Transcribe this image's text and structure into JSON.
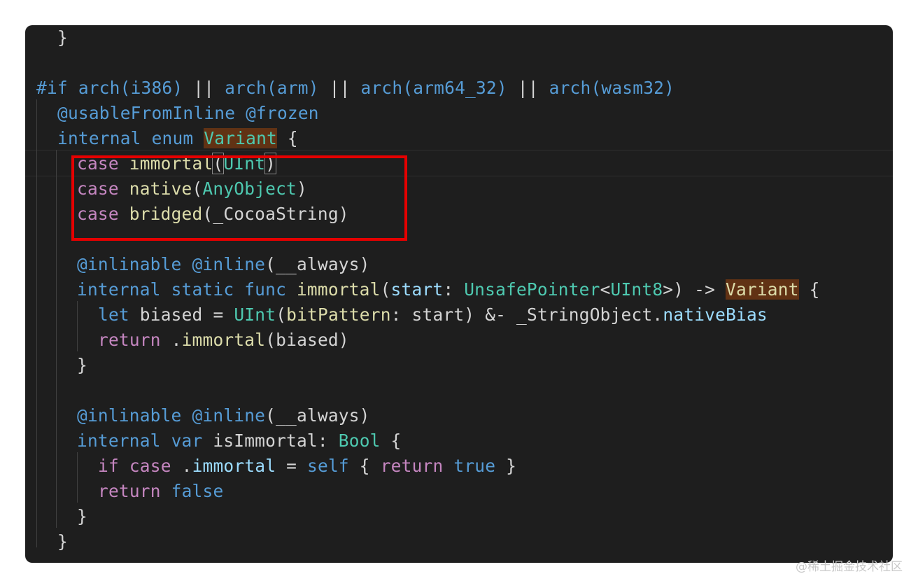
{
  "code": {
    "l1_brace": "}",
    "l3_if": "#if",
    "l3_arch1": "arch(i386)",
    "l3_or1": " || ",
    "l3_arch2": "arch(arm)",
    "l3_or2": " || ",
    "l3_arch3": "arch(arm64_32)",
    "l3_or3": " || ",
    "l3_arch4": "arch(wasm32)",
    "l4_attr1": "@usableFromInline",
    "l4_attr2": "@frozen",
    "l5_internal": "internal",
    "l5_enum": "enum",
    "l5_name": "Variant",
    "l5_brace": " {",
    "l6_case": "case",
    "l6_name": "immortal",
    "l6_open": "(",
    "l6_type": "UInt",
    "l6_close": ")",
    "l7_case": "case",
    "l7_name": "native",
    "l7_open": "(",
    "l7_type": "AnyObject",
    "l7_close": ")",
    "l8_case": "case",
    "l8_name": "bridged",
    "l8_rest": "(_CocoaString)",
    "l10_attr1": "@inlinable",
    "l10_attr2": "@inline",
    "l10_rest": "(__always)",
    "l11_internal": "internal",
    "l11_static": "static",
    "l11_func": "func",
    "l11_name": "immortal",
    "l11_open": "(",
    "l11_param": "start",
    "l11_colon": ": ",
    "l11_type1": "UnsafePointer",
    "l11_lt": "<",
    "l11_type2": "UInt8",
    "l11_gt": ">) -> ",
    "l11_ret": "Variant",
    "l11_brace": " {",
    "l12_let": "let",
    "l12_var": " biased = ",
    "l12_type": "UInt",
    "l12_open": "(",
    "l12_arg": "bitPattern",
    "l12_mid": ": start) &- _StringObject.",
    "l12_prop": "nativeBias",
    "l13_return": "return",
    "l13_dot": " .",
    "l13_call": "immortal",
    "l13_rest": "(biased)",
    "l14_brace": "}",
    "l16_attr1": "@inlinable",
    "l16_attr2": "@inline",
    "l16_rest": "(__always)",
    "l17_internal": "internal",
    "l17_var": "var",
    "l17_name": "isImmortal",
    "l17_colon": ": ",
    "l17_type": "Bool",
    "l17_brace": " {",
    "l18_if": "if",
    "l18_case": "case",
    "l18_dot": " .",
    "l18_member": "immortal",
    "l18_eq": " = ",
    "l18_self": "self",
    "l18_open": " { ",
    "l18_return": "return",
    "l18_true": "true",
    "l18_close": " }",
    "l19_return": "return",
    "l19_false": "false",
    "l20_brace": "}",
    "l21_brace": "}"
  },
  "colors": {
    "background": "#1e1e1e",
    "keyword": "#569cd6",
    "control": "#c586c0",
    "type": "#4ec9b0",
    "function": "#dcdcaa",
    "highlight_box": "#e50000"
  },
  "watermark": "@稀土掘金技术社区"
}
